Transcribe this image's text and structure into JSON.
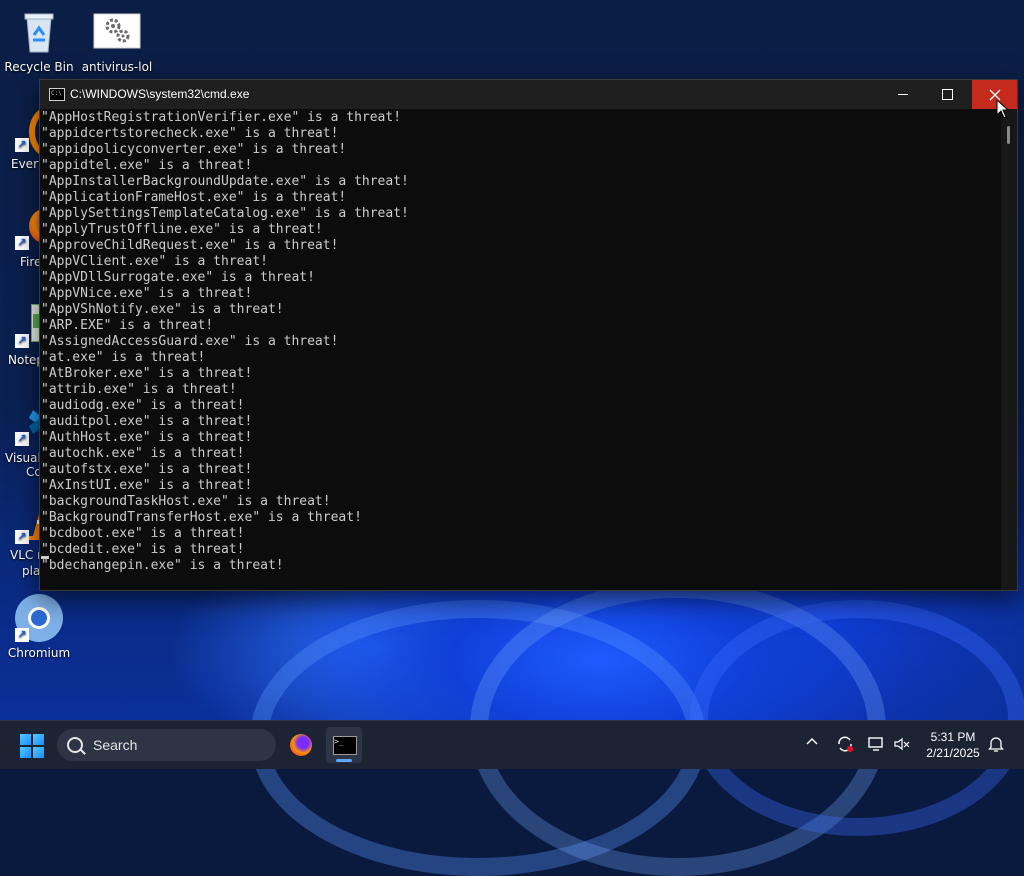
{
  "desktop": {
    "icons": [
      {
        "label": "Recycle Bin"
      },
      {
        "label": "antivirus-lol"
      },
      {
        "label": "Chromium"
      }
    ],
    "partial_labels": [
      "Every",
      "Fire",
      "Notep",
      "Visual",
      "Co",
      "VLC r",
      "pla"
    ]
  },
  "cmd_window": {
    "title": "C:\\WINDOWS\\system32\\cmd.exe",
    "lines": [
      "\"AppHostRegistrationVerifier.exe\" is a threat!",
      "\"appidcertstorecheck.exe\" is a threat!",
      "\"appidpolicyconverter.exe\" is a threat!",
      "\"appidtel.exe\" is a threat!",
      "\"AppInstallerBackgroundUpdate.exe\" is a threat!",
      "\"ApplicationFrameHost.exe\" is a threat!",
      "\"ApplySettingsTemplateCatalog.exe\" is a threat!",
      "\"ApplyTrustOffline.exe\" is a threat!",
      "\"ApproveChildRequest.exe\" is a threat!",
      "\"AppVClient.exe\" is a threat!",
      "\"AppVDllSurrogate.exe\" is a threat!",
      "\"AppVNice.exe\" is a threat!",
      "\"AppVShNotify.exe\" is a threat!",
      "\"ARP.EXE\" is a threat!",
      "\"AssignedAccessGuard.exe\" is a threat!",
      "\"at.exe\" is a threat!",
      "\"AtBroker.exe\" is a threat!",
      "\"attrib.exe\" is a threat!",
      "\"audiodg.exe\" is a threat!",
      "\"auditpol.exe\" is a threat!",
      "\"AuthHost.exe\" is a threat!",
      "\"autochk.exe\" is a threat!",
      "\"autofstx.exe\" is a threat!",
      "\"AxInstUI.exe\" is a threat!",
      "\"backgroundTaskHost.exe\" is a threat!",
      "\"BackgroundTransferHost.exe\" is a threat!",
      "\"bcdboot.exe\" is a threat!",
      "\"bcdedit.exe\" is a threat!",
      "\"bdechangepin.exe\" is a threat!"
    ]
  },
  "taskbar": {
    "search_label": "Search",
    "time": "5:31 PM",
    "date": "2/21/2025"
  },
  "colors": {
    "close_button": "#c42b1c",
    "console_text": "#cccccc",
    "console_bg": "#0c0c0c",
    "taskbar_bg": "#1c2333"
  }
}
